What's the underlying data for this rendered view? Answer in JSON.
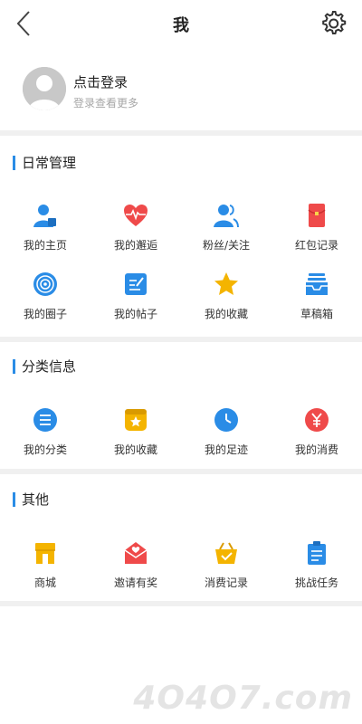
{
  "header": {
    "title": "我",
    "back_icon": "chevron-left-icon",
    "settings_icon": "gear-icon"
  },
  "profile": {
    "login_label": "点击登录",
    "login_hint": "登录查看更多"
  },
  "sections": [
    {
      "title": "日常管理",
      "items": [
        {
          "label": "我的主页",
          "icon": "user-card-icon",
          "color": "#2a8ce6"
        },
        {
          "label": "我的邂逅",
          "icon": "heart-pulse-icon",
          "color": "#ef4a4a"
        },
        {
          "label": "粉丝/关注",
          "icon": "fans-icon",
          "color": "#2a8ce6"
        },
        {
          "label": "红包记录",
          "icon": "red-envelope-icon",
          "color": "#ef4a4a"
        },
        {
          "label": "我的圈子",
          "icon": "circle-target-icon",
          "color": "#2a8ce6"
        },
        {
          "label": "我的帖子",
          "icon": "post-edit-icon",
          "color": "#2a8ce6"
        },
        {
          "label": "我的收藏",
          "icon": "star-icon",
          "color": "#f4b400"
        },
        {
          "label": "草稿箱",
          "icon": "inbox-tray-icon",
          "color": "#2a8ce6"
        }
      ]
    },
    {
      "title": "分类信息",
      "items": [
        {
          "label": "我的分类",
          "icon": "category-list-icon",
          "color": "#2a8ce6"
        },
        {
          "label": "我的收藏",
          "icon": "favorite-box-icon",
          "color": "#f4b400"
        },
        {
          "label": "我的足迹",
          "icon": "clock-icon",
          "color": "#2a8ce6"
        },
        {
          "label": "我的消费",
          "icon": "yen-icon",
          "color": "#ef4a4a"
        }
      ]
    },
    {
      "title": "其他",
      "items": [
        {
          "label": "商城",
          "icon": "shop-icon",
          "color": "#f4b400"
        },
        {
          "label": "邀请有奖",
          "icon": "mail-heart-icon",
          "color": "#ef4a4a"
        },
        {
          "label": "消费记录",
          "icon": "basket-check-icon",
          "color": "#f4b400"
        },
        {
          "label": "挑战任务",
          "icon": "clipboard-icon",
          "color": "#2a8ce6"
        }
      ]
    }
  ],
  "watermark": "4O4O7.com"
}
